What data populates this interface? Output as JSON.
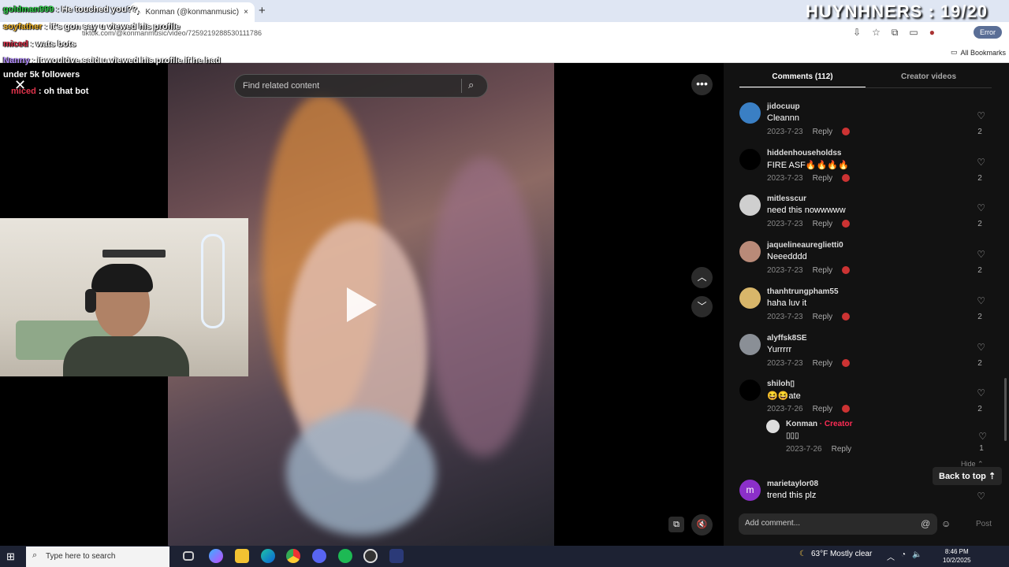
{
  "browser": {
    "tab_title": "Konman (@konmanmusic) | Ti...",
    "url": "tiktok.com/@konmanmusic/video/7259219288530111786",
    "error_label": "Error",
    "bookmarks_label": "All Bookmarks",
    "new_tab": "+",
    "close_tab": "×"
  },
  "overlay": {
    "counter": "HUYNHNERS : 19/20",
    "chat": [
      {
        "user": "goldman999",
        "msg": ": He touched you??",
        "color": "#2fd04a"
      },
      {
        "user": "soyfather",
        "msg": ": it's gon say u viewed his profile",
        "color": "#f0b429"
      },
      {
        "user": "miced",
        "msg": ": wats bots",
        "color": "#e0334b"
      },
      {
        "user": "Nanny",
        "msg": ": it wouldve said u viewed his profile if he had",
        "color": "#b48cff"
      },
      {
        "user": "",
        "msg": "under 5k followers",
        "color": "#ffffff"
      },
      {
        "user": "miced",
        "msg": ": oh that bot",
        "color": "#e0334b"
      }
    ]
  },
  "video": {
    "search_placeholder": "Find related content",
    "more_label": "•••",
    "up_label": "︿",
    "down_label": "﹀",
    "mute_label": "🔇",
    "pip_label": "⧉"
  },
  "panel": {
    "tab_comments": "Comments (112)",
    "tab_creator": "Creator videos",
    "comments": [
      {
        "user": "jidocuup",
        "text": "Cleannn",
        "date": "2023-7-23",
        "likes": "2",
        "avatar_color": "#3a7fc4"
      },
      {
        "user": "hiddenhouseholdss",
        "text": "FIRE ASF🔥🔥🔥🔥",
        "date": "2023-7-23",
        "likes": "2",
        "avatar_color": "#000000"
      },
      {
        "user": "mitlesscur",
        "text": "need this nowwwww",
        "date": "2023-7-23",
        "likes": "2",
        "avatar_color": "#cfcfcf"
      },
      {
        "user": "jaquelineaureglietti0",
        "text": "Neeedddd",
        "date": "2023-7-23",
        "likes": "2",
        "avatar_color": "#b98a78"
      },
      {
        "user": "thanhtrungpham55",
        "text": "haha luv it",
        "date": "2023-7-23",
        "likes": "2",
        "avatar_color": "#d8b66a"
      },
      {
        "user": "alyffsk8SE",
        "text": "Yurrrrr",
        "date": "2023-7-23",
        "likes": "2",
        "avatar_color": "#8a8f96"
      },
      {
        "user": "shiloh▯",
        "text": "😆😆ate",
        "date": "2023-7-26",
        "likes": "2",
        "avatar_color": "#000000"
      }
    ],
    "reply": {
      "user": "Konman",
      "creator_tag": "· Creator",
      "text": "▯▯▯",
      "date": "2023-7-26",
      "likes": "1",
      "reply_label": "Reply"
    },
    "last_comment": {
      "user": "marietaylor08",
      "text": "trend this plz",
      "initial": "m"
    },
    "reply_label": "Reply",
    "hide_label": "Hide ⌃",
    "back_to_top": "Back to top ⇡",
    "add_comment_placeholder": "Add comment...",
    "post_label": "Post"
  },
  "taskbar": {
    "search_placeholder": "Type here to search",
    "weather": "63°F  Mostly clear",
    "time": "8:46 PM",
    "date": "10/2/2025"
  },
  "colors": {
    "accent_creator": "#fe2c55",
    "panel_bg": "#121212"
  }
}
